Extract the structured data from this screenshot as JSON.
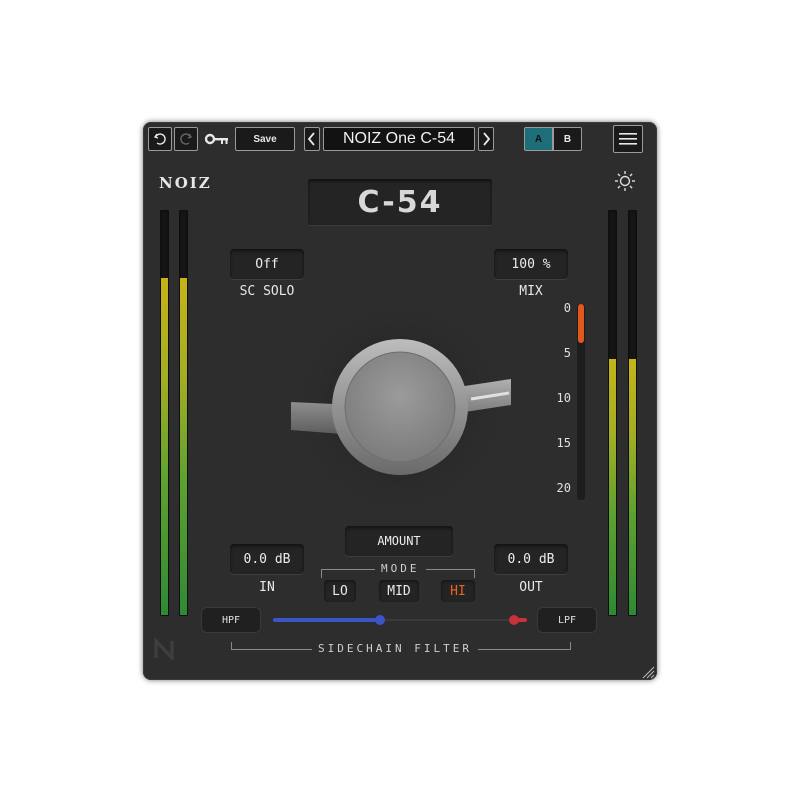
{
  "toolbar": {
    "undo_icon": "undo-icon",
    "redo_icon": "redo-icon",
    "key_icon": "key-icon",
    "save_label": "Save",
    "preset_name": "NOIZ One C-54",
    "prev_icon": "chevron-left-icon",
    "next_icon": "chevron-right-icon",
    "a_label": "A",
    "b_label": "B",
    "menu_icon": "hamburger-menu-icon",
    "active_slot": "A",
    "active_color": "#1e6e7a"
  },
  "header": {
    "brand": "NOIZ",
    "title": "C-54",
    "theme_icon": "sun-icon"
  },
  "controls": {
    "sc_solo": {
      "value": "Off",
      "label": "SC SOLO"
    },
    "mix": {
      "value": "100 %",
      "label": "MIX"
    },
    "amount_label": "AMOUNT",
    "input": {
      "value": "0.0 dB",
      "label": "IN"
    },
    "output": {
      "value": "0.0 dB",
      "label": "OUT"
    }
  },
  "mode": {
    "label": "MODE",
    "options": [
      "LO",
      "MID",
      "HI"
    ],
    "selected": "HI",
    "selected_color": "#e8661c"
  },
  "gain_reduction": {
    "scale": [
      "0",
      "5",
      "10",
      "15",
      "20"
    ],
    "level": 5,
    "max": 20,
    "color": "#e0581e"
  },
  "meters": {
    "input_level": 0.83,
    "output_level": 0.63
  },
  "sidechain": {
    "label": "SIDECHAIN FILTER",
    "hpf_label": "HPF",
    "lpf_label": "LPF",
    "hpf_position": 0.42,
    "lpf_position": 0.95,
    "hpf_color": "#3a55c8",
    "lpf_color": "#c8303a"
  },
  "footer": {
    "logo_icon": "noiz-n-logo-icon",
    "resize_icon": "resize-grip-icon"
  }
}
